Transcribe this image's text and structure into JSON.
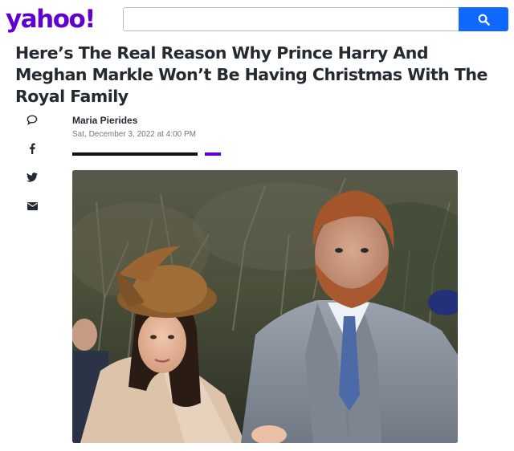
{
  "header": {
    "logo_text": "yahoo!",
    "search": {
      "placeholder": "",
      "value": ""
    },
    "search_button_icon": "search-icon",
    "brand_color": "#6001d2",
    "search_button_color": "#0f69ff"
  },
  "article": {
    "title": "Here’s The Real Reason Why Prince Harry And Meghan Markle Won’t Be Having Christmas With The Royal Family",
    "author": "Maria Pierides",
    "date": "Sat, December 3, 2022 at 4:00 PM"
  },
  "share_icons": [
    "comment-icon",
    "facebook-icon",
    "twitter-icon",
    "email-icon"
  ],
  "image": {
    "subject": "photo-of-couple-outdoors"
  }
}
